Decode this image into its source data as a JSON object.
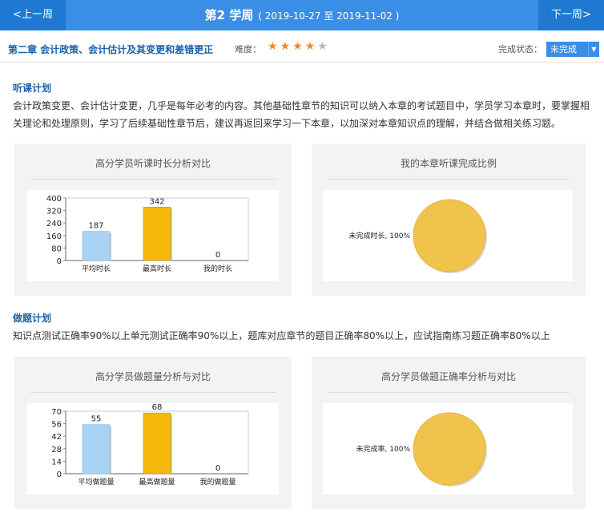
{
  "week": {
    "prev_label": "<上一周",
    "next_label": "下一周>",
    "title": "第2 学周",
    "range": "( 2019-10-27 至 2019-11-02 )"
  },
  "chapter": {
    "title": "第二章 会计政策、会计估计及其变更和差错更正",
    "difficulty_label": "难度：",
    "difficulty_stars": 4,
    "difficulty_max": 5,
    "status_label": "完成状态：",
    "status_value": "未完成"
  },
  "listen_plan": {
    "title": "听课计划",
    "text": "会计政策变更、会计估计变更，几乎是每年必考的内容。其他基础性章节的知识可以纳入本章的考试题目中，学员学习本章时，要掌握相关理论和处理原则，学习了后续基础性章节后，建议再返回来学习一下本章，以加深对本章知识点的理解，并结合做相关练习题。"
  },
  "practice_plan": {
    "title": "做题计划",
    "text": "知识点测试正确率90%以上单元测试正确率90%以上，题库对应章节的题目正确率80%以上，应试指南练习题正确率80%以上"
  },
  "panels": {
    "listen_compare_title": "高分学员听课时长分析对比",
    "listen_ratio_title": "我的本章听课完成比例",
    "practice_compare_title": "高分学员做题量分析与对比",
    "practice_ratio_title": "高分学员做题正确率分析与对比"
  },
  "colors": {
    "bar_avg": "#a9d3f5",
    "bar_max": "#f5b80a",
    "pie": "#f0c34d",
    "accent": "#3a8ee6"
  },
  "chart_data": [
    {
      "type": "bar",
      "categories": [
        "平均时长",
        "最高时长",
        "我的时长"
      ],
      "values": [
        187,
        342,
        0
      ],
      "ylim": [
        0,
        400
      ],
      "yticks": [
        0,
        80,
        160,
        240,
        320,
        400
      ]
    },
    {
      "type": "pie",
      "labels": [
        "未完成时长, 100%"
      ],
      "values": [
        100
      ]
    },
    {
      "type": "bar",
      "categories": [
        "平均做题量",
        "最高做题量",
        "我的做题量"
      ],
      "values": [
        55,
        68,
        0
      ],
      "ylim": [
        0,
        70
      ],
      "yticks": [
        0,
        14,
        28,
        42,
        56,
        70
      ]
    },
    {
      "type": "pie",
      "labels": [
        "未完成率, 100%"
      ],
      "values": [
        100
      ]
    }
  ]
}
